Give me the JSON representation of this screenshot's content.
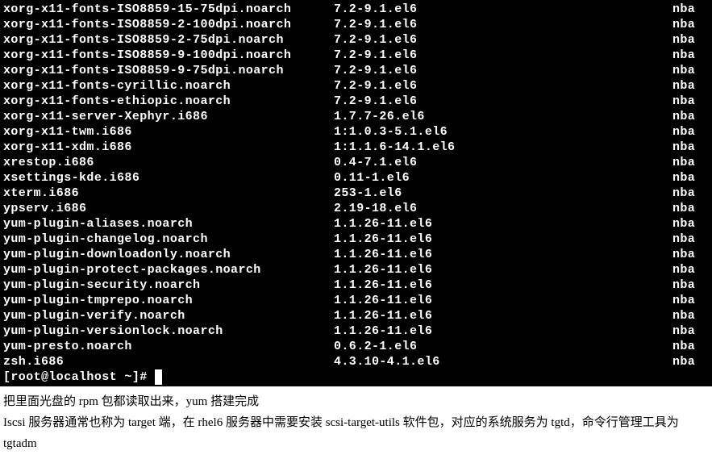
{
  "terminal": {
    "rows": [
      {
        "pkg": "xorg-x11-fonts-ISO8859-15-75dpi.noarch",
        "ver": "7.2-9.1.el6",
        "repo": "nba"
      },
      {
        "pkg": "xorg-x11-fonts-ISO8859-2-100dpi.noarch",
        "ver": "7.2-9.1.el6",
        "repo": "nba"
      },
      {
        "pkg": "xorg-x11-fonts-ISO8859-2-75dpi.noarch",
        "ver": "7.2-9.1.el6",
        "repo": "nba"
      },
      {
        "pkg": "xorg-x11-fonts-ISO8859-9-100dpi.noarch",
        "ver": "7.2-9.1.el6",
        "repo": "nba"
      },
      {
        "pkg": "xorg-x11-fonts-ISO8859-9-75dpi.noarch",
        "ver": "7.2-9.1.el6",
        "repo": "nba"
      },
      {
        "pkg": "xorg-x11-fonts-cyrillic.noarch",
        "ver": "7.2-9.1.el6",
        "repo": "nba"
      },
      {
        "pkg": "xorg-x11-fonts-ethiopic.noarch",
        "ver": "7.2-9.1.el6",
        "repo": "nba"
      },
      {
        "pkg": "xorg-x11-server-Xephyr.i686",
        "ver": "1.7.7-26.el6",
        "repo": "nba"
      },
      {
        "pkg": "xorg-x11-twm.i686",
        "ver": "1:1.0.3-5.1.el6",
        "repo": "nba"
      },
      {
        "pkg": "xorg-x11-xdm.i686",
        "ver": "1:1.1.6-14.1.el6",
        "repo": "nba"
      },
      {
        "pkg": "xrestop.i686",
        "ver": "0.4-7.1.el6",
        "repo": "nba"
      },
      {
        "pkg": "xsettings-kde.i686",
        "ver": "0.11-1.el6",
        "repo": "nba"
      },
      {
        "pkg": "xterm.i686",
        "ver": "253-1.el6",
        "repo": "nba"
      },
      {
        "pkg": "ypserv.i686",
        "ver": "2.19-18.el6",
        "repo": "nba"
      },
      {
        "pkg": "yum-plugin-aliases.noarch",
        "ver": "1.1.26-11.el6",
        "repo": "nba"
      },
      {
        "pkg": "yum-plugin-changelog.noarch",
        "ver": "1.1.26-11.el6",
        "repo": "nba"
      },
      {
        "pkg": "yum-plugin-downloadonly.noarch",
        "ver": "1.1.26-11.el6",
        "repo": "nba"
      },
      {
        "pkg": "yum-plugin-protect-packages.noarch",
        "ver": "1.1.26-11.el6",
        "repo": "nba"
      },
      {
        "pkg": "yum-plugin-security.noarch",
        "ver": "1.1.26-11.el6",
        "repo": "nba"
      },
      {
        "pkg": "yum-plugin-tmprepo.noarch",
        "ver": "1.1.26-11.el6",
        "repo": "nba"
      },
      {
        "pkg": "yum-plugin-verify.noarch",
        "ver": "1.1.26-11.el6",
        "repo": "nba"
      },
      {
        "pkg": "yum-plugin-versionlock.noarch",
        "ver": "1.1.26-11.el6",
        "repo": "nba"
      },
      {
        "pkg": "yum-presto.noarch",
        "ver": "0.6.2-1.el6",
        "repo": "nba"
      },
      {
        "pkg": "zsh.i686",
        "ver": "4.3.10-4.1.el6",
        "repo": "nba"
      }
    ],
    "prompt": "[root@localhost ~]# "
  },
  "description": {
    "line1": "把里面光盘的 rpm 包都读取出来，yum 搭建完成",
    "line2": "Iscsi 服务器通常也称为 target 端，在 rhel6 服务器中需要安装 scsi-target-utils 软件包，对应的系统服务为 tgtd，命令行管理工具为 tgtadm"
  }
}
